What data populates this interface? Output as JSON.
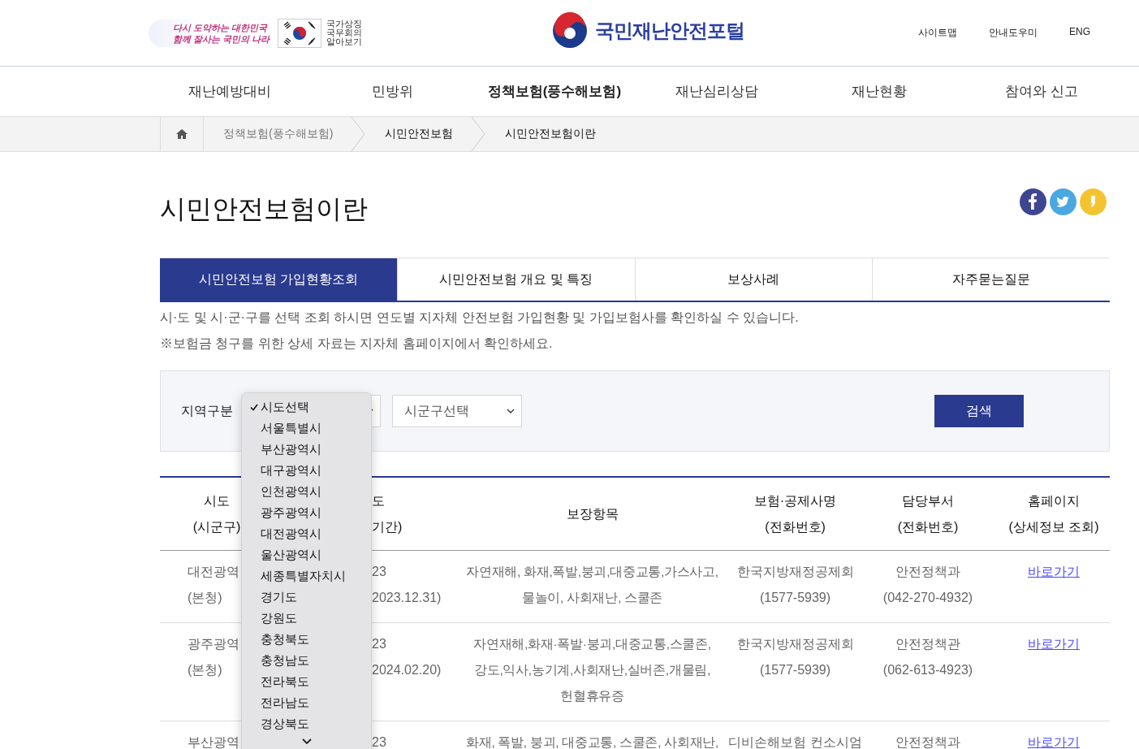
{
  "header": {
    "slogan": [
      "다시 도약하는 대한민국",
      "함께 잘사는 국민의 나라"
    ],
    "symbol_link": [
      "국가상징",
      "국무회의",
      "알아보기"
    ],
    "site_title": "국민재난안전포털",
    "util_links": [
      "사이트맵",
      "안내도우미",
      "ENG"
    ]
  },
  "nav": [
    {
      "label": "재난예방대비",
      "selected": false
    },
    {
      "label": "민방위",
      "selected": false
    },
    {
      "label": "정책보험(풍수해보험)",
      "selected": true
    },
    {
      "label": "재난심리상담",
      "selected": false
    },
    {
      "label": "재난현황",
      "selected": false
    },
    {
      "label": "참여와 신고",
      "selected": false
    }
  ],
  "breadcrumb": [
    "정책보험(풍수해보험)",
    "시민안전보험",
    "시민안전보험이란"
  ],
  "page_title": "시민안전보험이란",
  "tabs": [
    {
      "label": "시민안전보험 가입현황조회",
      "selected": true
    },
    {
      "label": "시민안전보험 개요 및 특징",
      "selected": false
    },
    {
      "label": "보상사례",
      "selected": false
    },
    {
      "label": "자주묻는질문",
      "selected": false
    }
  ],
  "notes": [
    "시·도 및 시·군·구를 선택 조회 하시면 연도별 지자체 안전보험 가입현황 및 가입보험사를 확인하실 수 있습니다.",
    "※보험금 청구를 위한 상세 자료는 지자체 홈페이지에서 확인하세요."
  ],
  "search": {
    "label": "지역구분",
    "sido": {
      "open": true,
      "options": [
        {
          "label": "시도선택",
          "selected": true
        },
        {
          "label": "서울특별시",
          "selected": false
        },
        {
          "label": "부산광역시",
          "selected": false
        },
        {
          "label": "대구광역시",
          "selected": false
        },
        {
          "label": "인천광역시",
          "selected": false
        },
        {
          "label": "광주광역시",
          "selected": false
        },
        {
          "label": "대전광역시",
          "selected": false
        },
        {
          "label": "울산광역시",
          "selected": false
        },
        {
          "label": "세종특별자치시",
          "selected": false
        },
        {
          "label": "경기도",
          "selected": false
        },
        {
          "label": "강원도",
          "selected": false
        },
        {
          "label": "충청북도",
          "selected": false
        },
        {
          "label": "충청남도",
          "selected": false
        },
        {
          "label": "전라북도",
          "selected": false
        },
        {
          "label": "전라남도",
          "selected": false
        },
        {
          "label": "경상북도",
          "selected": false
        }
      ]
    },
    "sigungu": {
      "value": "시군구선택"
    },
    "button": "검색"
  },
  "table": {
    "columns": [
      {
        "lines": [
          "시도",
          "(시군구)"
        ]
      },
      {
        "lines": [
          "도",
          "기간)"
        ]
      },
      {
        "lines": [
          "보장항목"
        ]
      },
      {
        "lines": [
          "보험·공제사명",
          "(전화번호)"
        ]
      },
      {
        "lines": [
          "담당부서",
          "(전화번호)"
        ]
      },
      {
        "lines": [
          "홈페이지",
          "(상세정보 조회)"
        ]
      }
    ],
    "rows": [
      {
        "cells": [
          {
            "lines": [
              "대전광역",
              "(본청)"
            ]
          },
          {
            "lines": [
              "23",
              "2023.12.31)"
            ]
          },
          {
            "lines": [
              "자연재해, 화재,폭발,붕괴,대중교통,가스사고,",
              "물놀이, 사회재난, 스쿨존"
            ]
          },
          {
            "lines": [
              "한국지방재정공제회",
              "(1577-5939)"
            ]
          },
          {
            "lines": [
              "안전정책과",
              "(042-270-4932)"
            ]
          }
        ],
        "link": "바로가기"
      },
      {
        "cells": [
          {
            "lines": [
              "광주광역",
              "(본청)"
            ]
          },
          {
            "lines": [
              "23",
              "2024.02.20)"
            ]
          },
          {
            "lines": [
              "자연재해,화재·폭발·붕괴,대중교통,스쿨존,",
              "강도,익사,농기계,사회재난,실버존,개물림,",
              "헌혈휴유증"
            ]
          },
          {
            "lines": [
              "한국지방재정공제회",
              "(1577-5939)"
            ]
          },
          {
            "lines": [
              "안전정책관",
              "(062-613-4923)"
            ]
          }
        ],
        "link": "바로가기"
      },
      {
        "cells": [
          {
            "lines": [
              "부산광역"
            ]
          },
          {
            "lines": [
              "23"
            ]
          },
          {
            "lines": [
              "화재, 폭발, 붕괴, 대중교통, 스쿨존, 사회재난,"
            ]
          },
          {
            "lines": [
              "디비손해보험 컨소시엄"
            ]
          },
          {
            "lines": [
              "안전정책과"
            ]
          }
        ],
        "link": "바로가기"
      }
    ]
  }
}
